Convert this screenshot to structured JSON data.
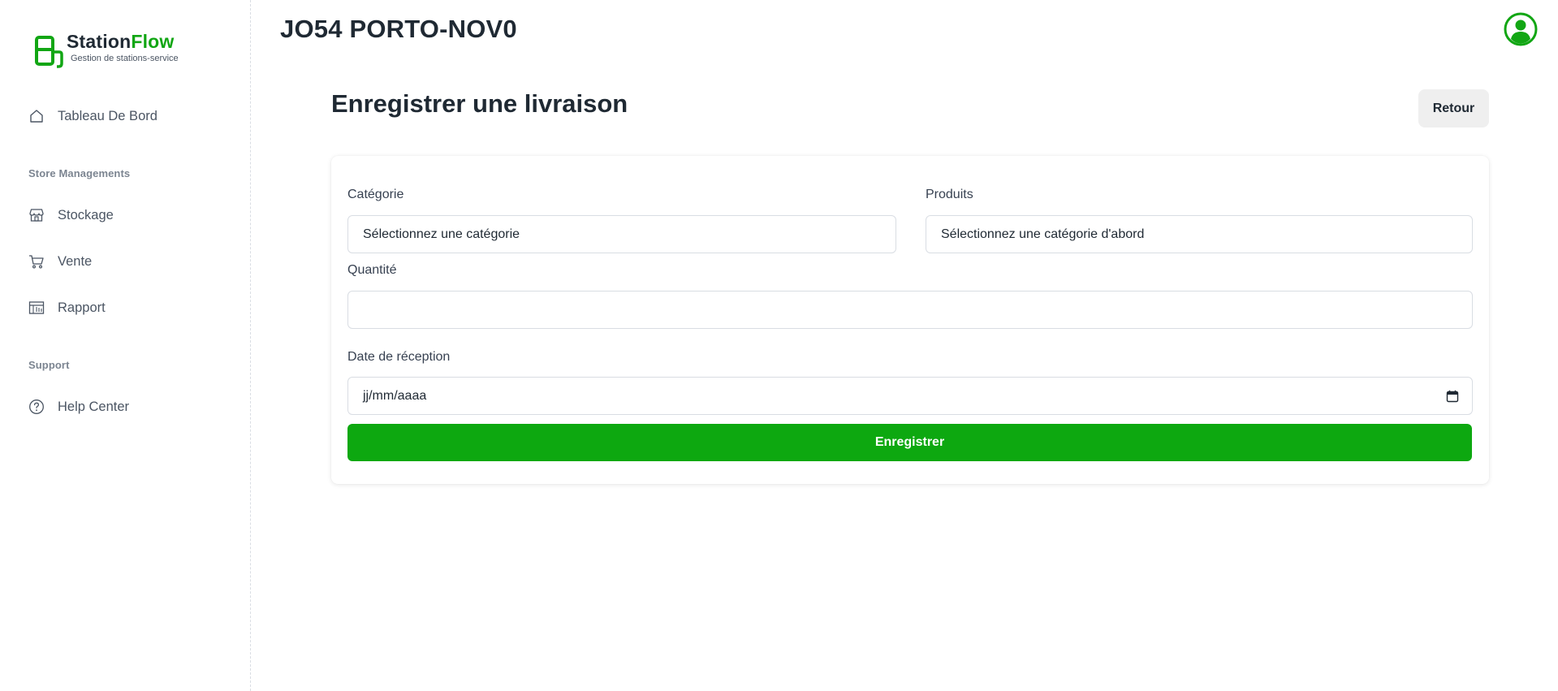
{
  "app": {
    "name_part1": "Station",
    "name_part2": "Flow",
    "tagline": "Gestion de stations-service",
    "brand_color": "#12a614"
  },
  "sidebar": {
    "dashboard": {
      "label": "Tableau De Bord",
      "icon": "home-icon"
    },
    "section_store": "Store Managements",
    "store_items": [
      {
        "label": "Stockage",
        "icon": "store-icon"
      },
      {
        "label": "Vente",
        "icon": "cart-icon"
      },
      {
        "label": "Rapport",
        "icon": "report-icon"
      }
    ],
    "section_support": "Support",
    "support_items": [
      {
        "label": "Help Center",
        "icon": "help-circle-icon"
      }
    ]
  },
  "header": {
    "station_name": "JO54 PORTO-NOV0",
    "avatar_icon": "user-circle-icon"
  },
  "page": {
    "title": "Enregistrer une livraison",
    "back_label": "Retour"
  },
  "form": {
    "category": {
      "label": "Catégorie",
      "value": "Sélectionnez une catégorie"
    },
    "products": {
      "label": "Produits",
      "value": "Sélectionnez une catégorie d'abord"
    },
    "quantity": {
      "label": "Quantité",
      "value": ""
    },
    "date": {
      "label": "Date de réception",
      "placeholder": "jj/mm/aaaa",
      "icon": "calendar-icon"
    },
    "submit_label": "Enregistrer",
    "submit_color": "#0da810"
  }
}
